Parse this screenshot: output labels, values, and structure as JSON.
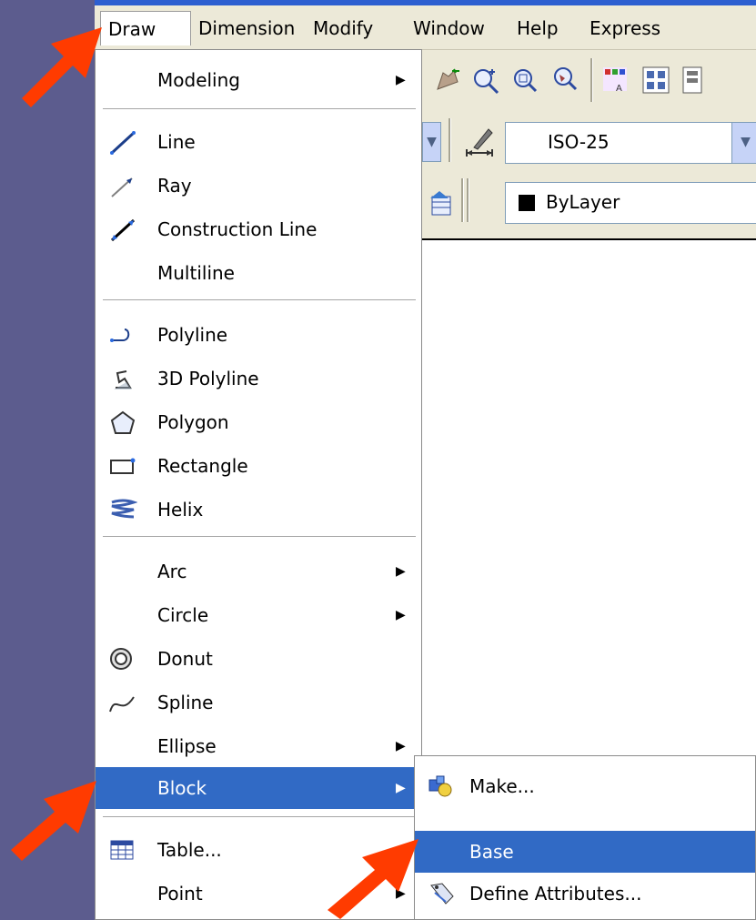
{
  "menubar": {
    "items": [
      "Draw",
      "Dimension",
      "Modify",
      "Window",
      "Help",
      "Express"
    ]
  },
  "toolbar": {
    "dimstyle": "ISO-25",
    "color": "ByLayer"
  },
  "draw_menu": {
    "items": [
      {
        "label": "Modeling",
        "icon": "none",
        "submenu": true
      },
      {
        "label": "Line",
        "icon": "line-icon"
      },
      {
        "label": "Ray",
        "icon": "ray-icon"
      },
      {
        "label": "Construction Line",
        "icon": "construction-line-icon"
      },
      {
        "label": "Multiline",
        "icon": "none"
      },
      {
        "label": "Polyline",
        "icon": "polyline-icon"
      },
      {
        "label": "3D Polyline",
        "icon": "3d-polyline-icon"
      },
      {
        "label": "Polygon",
        "icon": "polygon-icon"
      },
      {
        "label": "Rectangle",
        "icon": "rectangle-icon"
      },
      {
        "label": "Helix",
        "icon": "helix-icon"
      },
      {
        "label": "Arc",
        "icon": "none",
        "submenu": true
      },
      {
        "label": "Circle",
        "icon": "none",
        "submenu": true
      },
      {
        "label": "Donut",
        "icon": "donut-icon"
      },
      {
        "label": "Spline",
        "icon": "spline-icon"
      },
      {
        "label": "Ellipse",
        "icon": "none",
        "submenu": true
      },
      {
        "label": "Block",
        "icon": "none",
        "submenu": true,
        "highlighted": true
      },
      {
        "label": "Table...",
        "icon": "table-icon"
      },
      {
        "label": "Point",
        "icon": "none",
        "submenu": true
      }
    ]
  },
  "block_submenu": {
    "items": [
      {
        "label": "Make...",
        "icon": "make-block-icon"
      },
      {
        "label": "Base",
        "icon": "none",
        "highlighted": true
      },
      {
        "label": "Define Attributes...",
        "icon": "define-attributes-icon"
      }
    ]
  },
  "colors": {
    "highlight": "#316ac5",
    "annotation_arrow": "#ff3b00",
    "slide_background": "#5c5c8e"
  }
}
